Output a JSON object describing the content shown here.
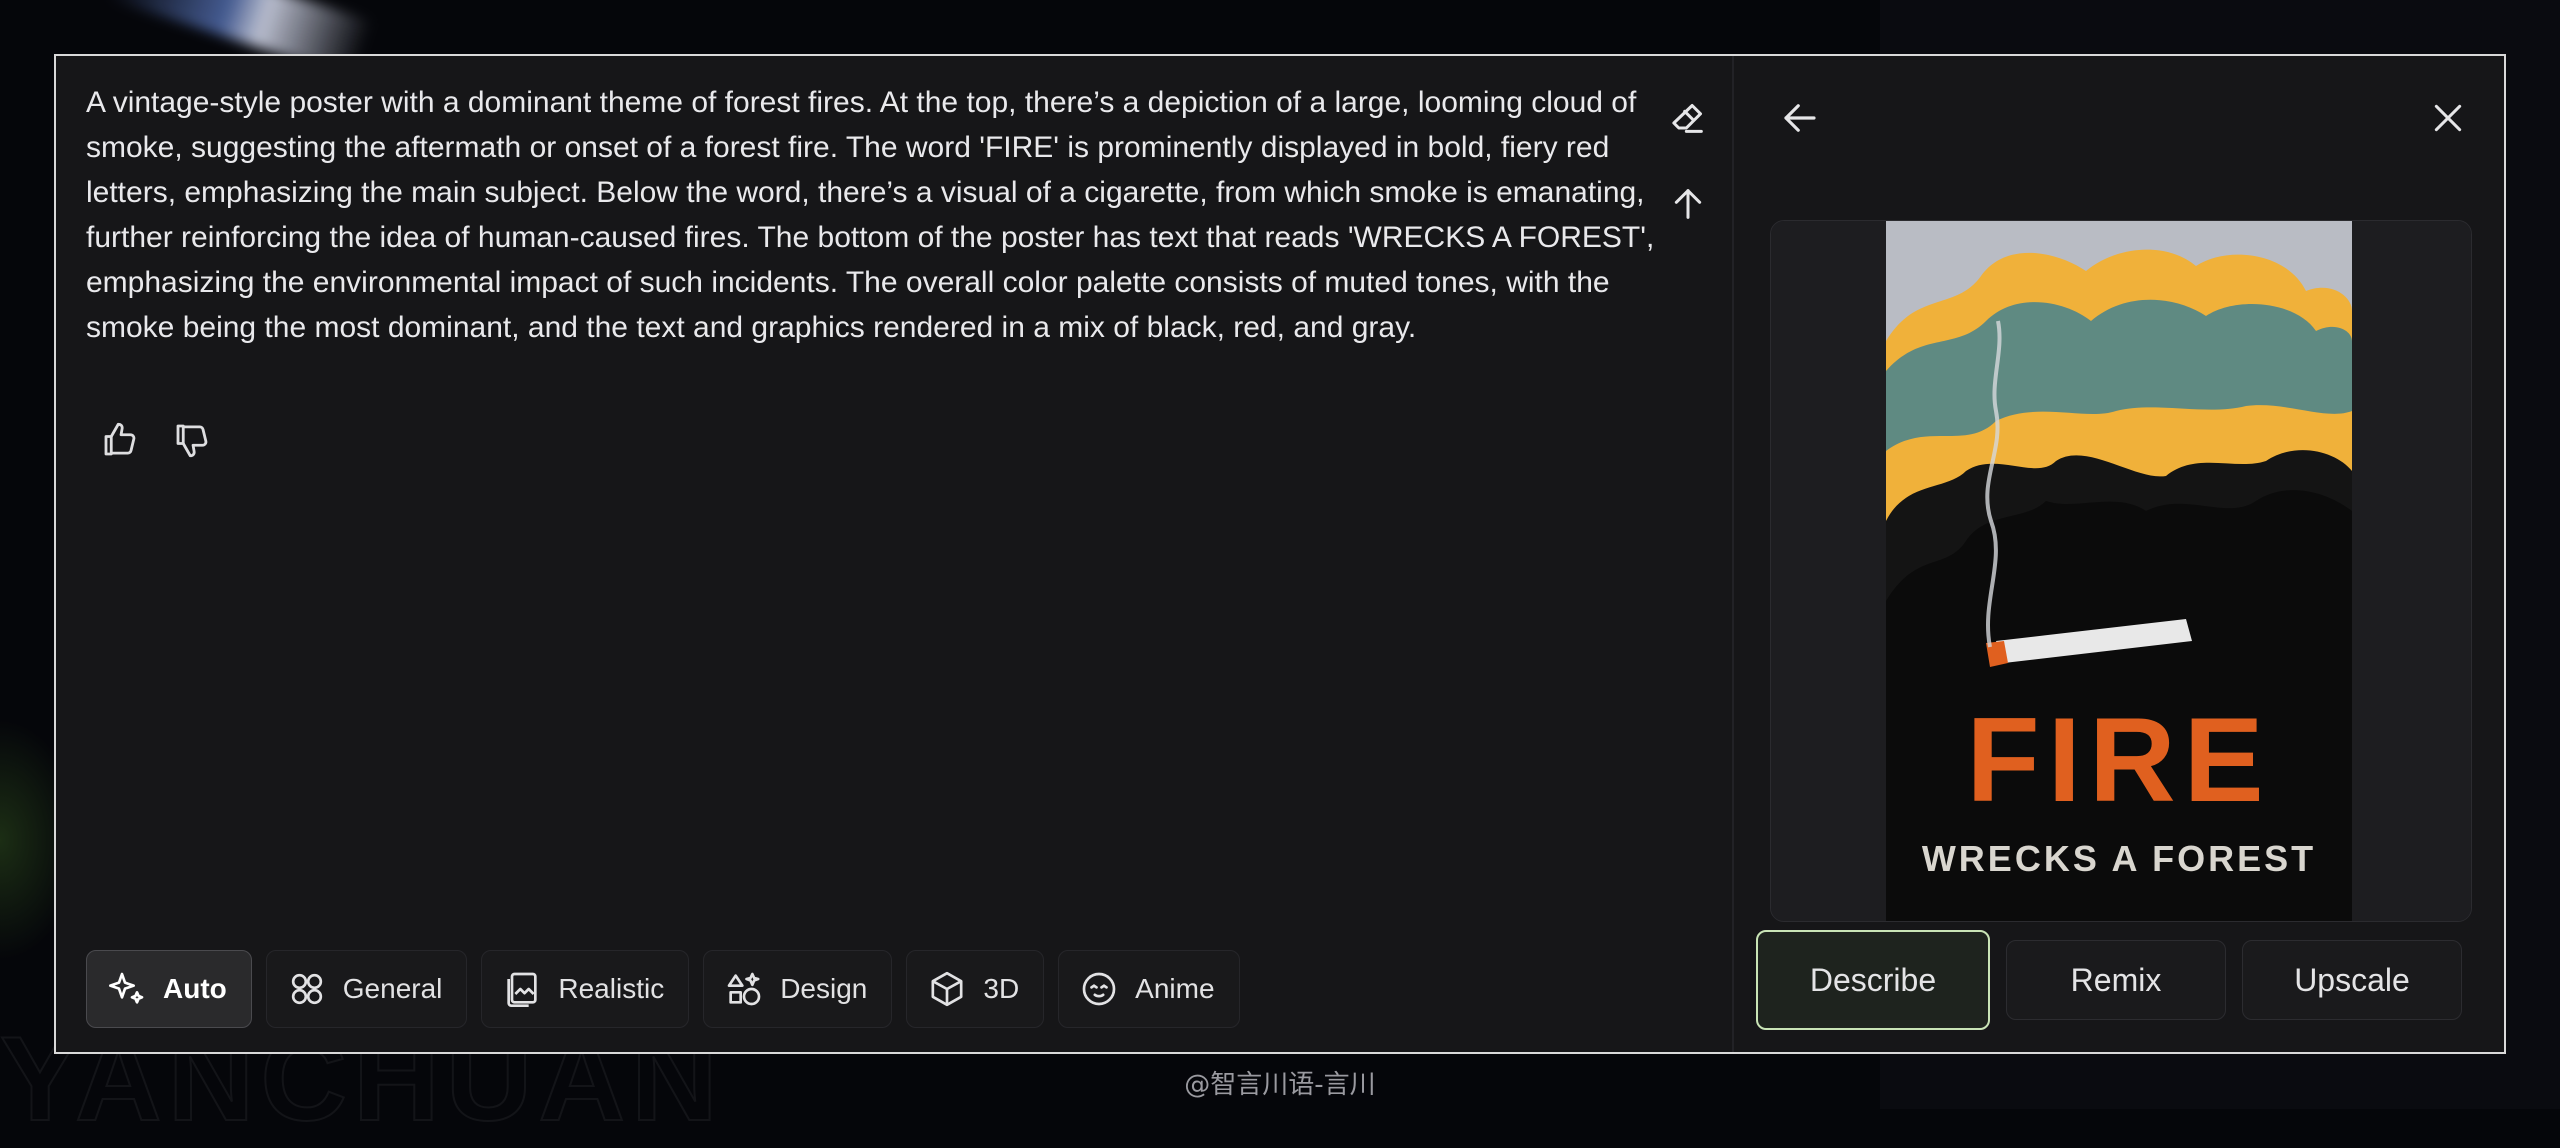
{
  "prompt": {
    "text": "A vintage-style poster with a dominant theme of forest fires. At the top, there’s a depiction of a large, looming cloud of smoke, suggesting the aftermath or onset of a forest fire. The word 'FIRE' is prominently displayed in bold, fiery red letters, emphasizing the main subject. Below the word, there’s a visual of a cigarette, from which smoke is emanating, further reinforcing the idea of human-caused fires. The bottom of the poster has text that reads 'WRECKS A FOREST', emphasizing the environmental impact of such incidents. The overall color palette consists of muted tones, with the smoke being the most dominant, and the text and graphics rendered in a mix of black, red, and gray."
  },
  "icons": {
    "clear": "eraser-icon",
    "submit": "arrow-up-icon",
    "like": "thumbs-up-icon",
    "dislike": "thumbs-down-icon",
    "back": "arrow-left-icon",
    "close": "close-icon"
  },
  "style_presets": [
    {
      "label": "Auto",
      "icon": "sparkles-icon",
      "active": true
    },
    {
      "label": "General",
      "icon": "grid-icon",
      "active": false
    },
    {
      "label": "Realistic",
      "icon": "photos-icon",
      "active": false
    },
    {
      "label": "Design",
      "icon": "shapes-icon",
      "active": false
    },
    {
      "label": "3D",
      "icon": "cube-icon",
      "active": false
    },
    {
      "label": "Anime",
      "icon": "face-icon",
      "active": false
    }
  ],
  "preview": {
    "poster_title": "FIRE",
    "poster_subtitle": "WRECKS A FOREST"
  },
  "actions": {
    "describe": "Describe",
    "remix": "Remix",
    "upscale": "Upscale"
  },
  "caption": "@智言川语-言川",
  "colors": {
    "window_bg": "#161618",
    "accent_selected": "#c9e4b6",
    "poster_orange": "#e0601f",
    "poster_yellow": "#f0b13a",
    "poster_teal": "#5f8a82"
  }
}
